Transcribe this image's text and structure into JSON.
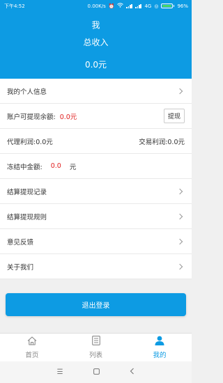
{
  "status": {
    "time": "下午4:52",
    "speed": "0.00K/s",
    "network": "4G",
    "battery": "96%"
  },
  "header": {
    "title": "我",
    "subtitle": "总收入",
    "amount": "0.0元"
  },
  "rows": {
    "personal_info": "我的个人信息",
    "withdrawable_label": "账户可提现余额:",
    "withdrawable_value": "0.0元",
    "withdraw_button": "提现",
    "agent_profit": "代理利润:0.0元",
    "trade_profit": "交易利润:0.0元",
    "frozen_label": "冻结中金额:",
    "frozen_value": "0.0",
    "frozen_unit": "元",
    "settlement_records": "结算提现记录",
    "settlement_rules": "结算提现规则",
    "feedback": "意见反馈",
    "about": "关于我们"
  },
  "logout_label": "退出登录",
  "tabs": [
    {
      "label": "首页",
      "icon": "home-icon",
      "active": false
    },
    {
      "label": "列表",
      "icon": "list-icon",
      "active": false
    },
    {
      "label": "我的",
      "icon": "user-icon",
      "active": true
    }
  ],
  "colors": {
    "accent": "#0d9be3",
    "highlight": "#e02020"
  }
}
